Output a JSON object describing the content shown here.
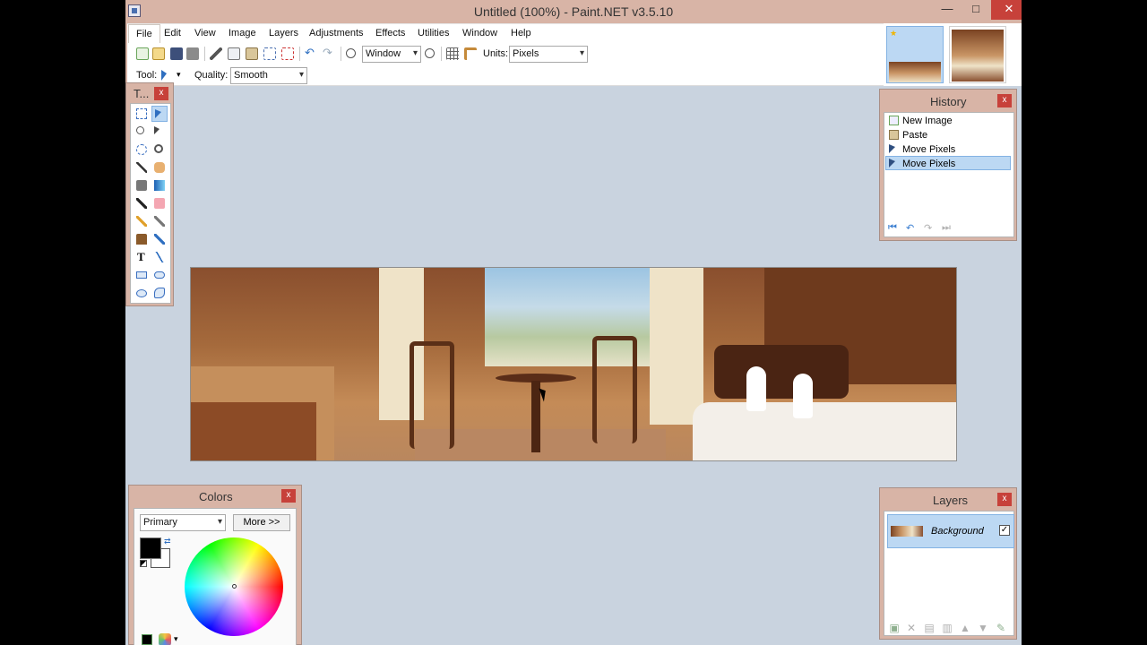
{
  "window": {
    "title": "Untitled (100%) - Paint.NET v3.5.10",
    "minimize": "—",
    "maximize": "□",
    "close": "✕"
  },
  "menu": [
    "File",
    "Edit",
    "View",
    "Image",
    "Layers",
    "Adjustments",
    "Effects",
    "Utilities",
    "Window",
    "Help"
  ],
  "toolbar": {
    "zoom_value": "Window",
    "units_label": "Units:",
    "units_value": "Pixels",
    "tool_label": "Tool:",
    "quality_label": "Quality:",
    "quality_value": "Smooth"
  },
  "tools_panel": {
    "title": "T...",
    "close": "x"
  },
  "history_panel": {
    "title": "History",
    "close": "x",
    "items": [
      "New Image",
      "Paste",
      "Move Pixels",
      "Move Pixels"
    ],
    "selected_index": 3
  },
  "colors_panel": {
    "title": "Colors",
    "close": "x",
    "mode_value": "Primary",
    "more_button": "More >>",
    "primary_color": "#000000",
    "secondary_color": "#ffffff"
  },
  "layers_panel": {
    "title": "Layers",
    "close": "x",
    "layers": [
      {
        "name": "Background",
        "visible": true
      }
    ],
    "check_mark": "✓"
  },
  "colors": {
    "frame": "#d8b4a6",
    "workspace": "#c9d3df",
    "selection": "#bcd8f3",
    "close_red": "#c7413a"
  }
}
